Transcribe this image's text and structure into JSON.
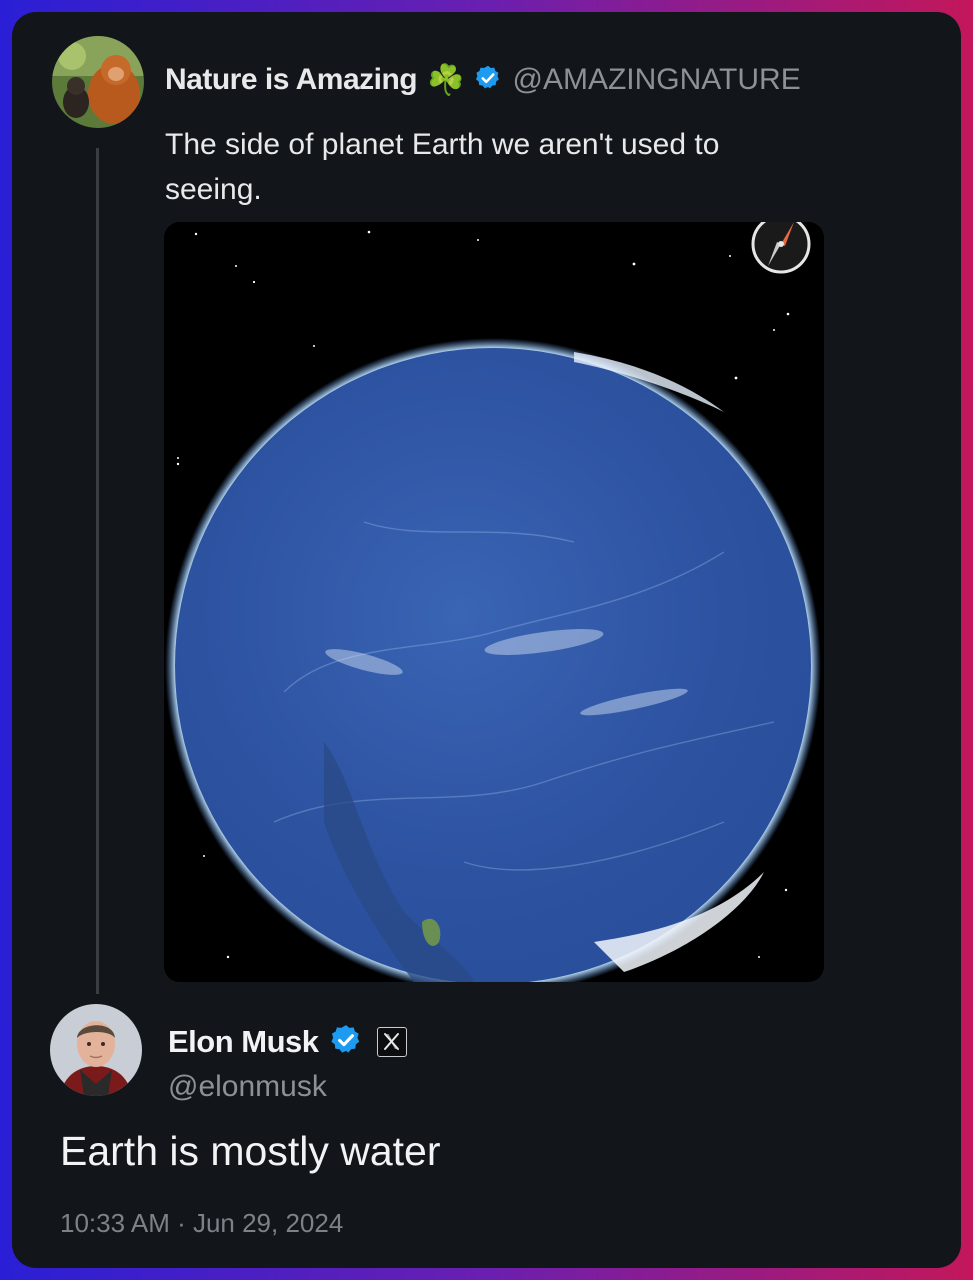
{
  "quoted_tweet": {
    "author_name": "Nature is Amazing",
    "author_emoji": "☘️",
    "handle": "@AMAZINGNATURE",
    "text": "The side of planet Earth we aren't used to seeing.",
    "verified_icon": "verified-badge-icon",
    "media_icon": "compass-icon"
  },
  "reply_tweet": {
    "author_name": "Elon Musk",
    "handle": "@elonmusk",
    "text": "Earth is mostly water",
    "timestamp": "10:33 AM · Jun 29, 2024",
    "verified_icon": "verified-badge-icon",
    "affiliate_icon": "x-logo-icon"
  },
  "colors": {
    "card_background": "#121519",
    "verified_blue": "#1d9bf0",
    "ocean_blue": "#2f58a8"
  }
}
